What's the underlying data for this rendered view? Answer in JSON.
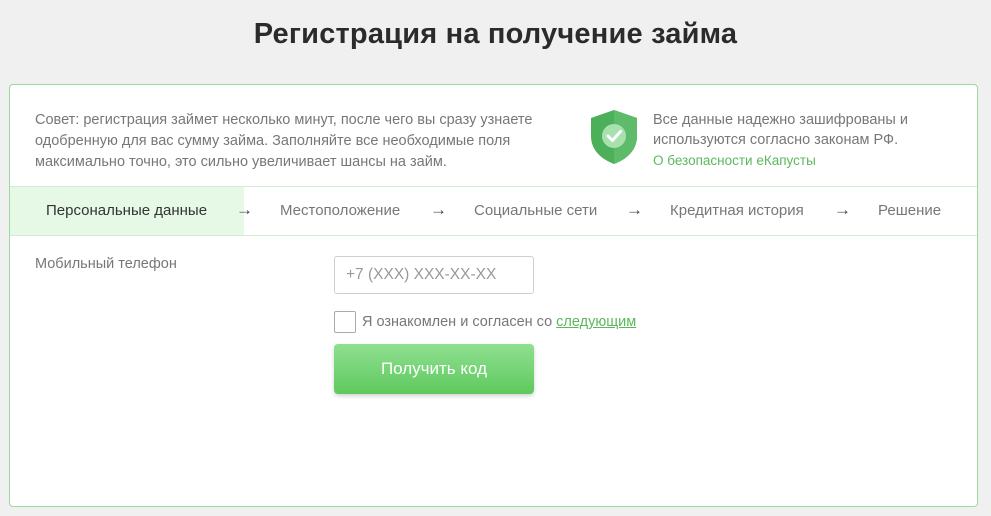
{
  "header": {
    "title": "Регистрация на получение займа"
  },
  "tip": {
    "text": "Совет: регистрация займет несколько минут, после чего вы сразу узнаете одобренную для вас сумму займа. Заполняйте все необходимые поля максимально точно, это сильно увеличивает шансы на займ."
  },
  "security": {
    "icon": "shield-check-icon",
    "text": "Все данные надежно зашифрованы и используются согласно законам РФ.",
    "link": "О безопасности еКапусты"
  },
  "steps": {
    "items": [
      {
        "label": "Персональные данные",
        "active": true
      },
      {
        "label": "Местоположение",
        "active": false
      },
      {
        "label": "Социальные сети",
        "active": false
      },
      {
        "label": "Кредитная история",
        "active": false
      },
      {
        "label": "Решение",
        "active": false
      }
    ],
    "arrow": "→"
  },
  "form": {
    "phone_label": "Мобильный телефон",
    "phone_placeholder": "+7 (XXX) XXX-XX-XX",
    "phone_value": "",
    "agree_checked": false,
    "agree_text": "Я ознакомлен и согласен со",
    "agree_link": "следующим",
    "submit_label": "Получить код"
  },
  "colors": {
    "accent": "#5cb85c",
    "button_top": "#8fe08f",
    "button_bottom": "#5ec95e",
    "shield_dark": "#4caf5a",
    "shield_light": "#7ed08a",
    "card_border": "#9fd99f",
    "active_step_bg": "#e6f8e6"
  }
}
